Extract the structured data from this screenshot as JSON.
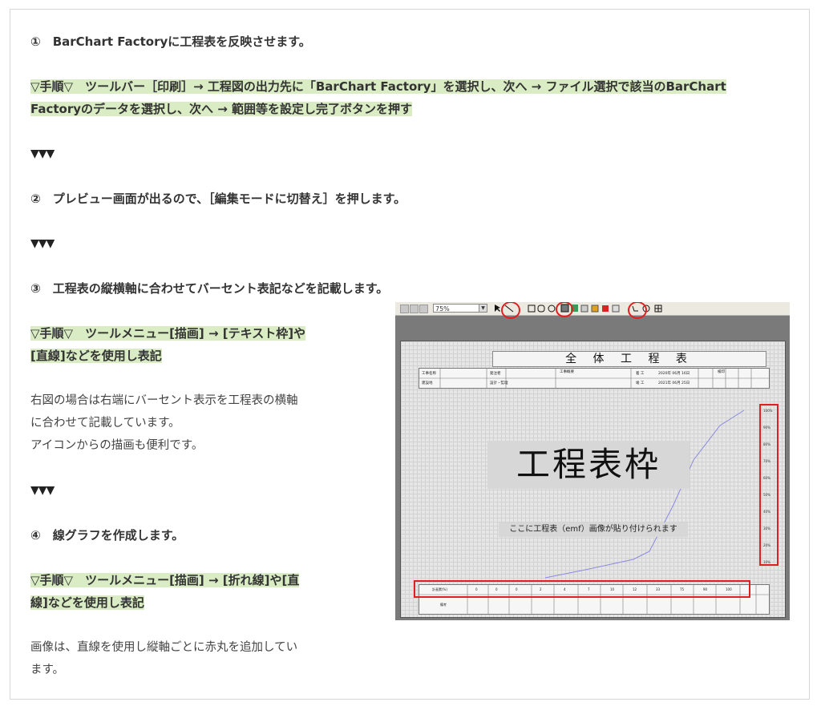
{
  "sections": {
    "step1_title": "①　BarChart Factoryに工程表を反映させます。",
    "step1_proc_line1": "▽手順▽　ツールバー［印刷］→ 工程図の出力先に「BarChart Factory」を選択し、次へ → ファイル選択で該当のBarChart",
    "step1_proc_line2": "Factoryのデータを選択し、次へ → 範囲等を設定し完了ボタンを押す",
    "arrows": "▼▼▼",
    "step2_title": "②　プレビュー画面が出るので、［編集モードに切替え］を押します。",
    "step3_title": "③　工程表の縦横軸に合わせてバーセント表記などを記載します。",
    "step3_proc_line1": "▽手順▽　ツールメニュー[描画] → [テキスト枠]や",
    "step3_proc_line2": "[直線]などを使用し表記",
    "step3_body_line1": "右図の場合は右端にバーセント表示を工程表の横軸",
    "step3_body_line2": "に合わせて記載しています。",
    "step3_body_line3": "アイコンからの描画も便利です。",
    "step4_title": "④　線グラフを作成します。",
    "step4_proc_line1": "▽手順▽　ツールメニュー[描画] → [折れ線]や[直",
    "step4_proc_line2": "線]などを使用し表記",
    "step4_body_line1": "画像は、直線を使用し縦軸ごとに赤丸を追加してい",
    "step4_body_line2": "ます。"
  },
  "screenshot": {
    "zoom": "75%",
    "sheet_title": "全 体 工 程 表",
    "header_labels": [
      "工事名称",
      "発注者",
      "工事概要",
      "着 工",
      "2020年 06月 16日",
      "検印",
      "建設地",
      "設計・監理",
      "竣 工",
      "2021年 06月 25日"
    ],
    "placeholder_big": "工程表枠",
    "placeholder_small": "ここに工程表（emf）画像が貼り付けられます",
    "percent_labels": [
      "100%",
      "90%",
      "80%",
      "70%",
      "60%",
      "50%",
      "40%",
      "30%",
      "20%",
      "10%"
    ],
    "progress_row_label": "計画累(%)",
    "progress_values": [
      "0",
      "0",
      "0",
      "2",
      "4",
      "7",
      "10",
      "12",
      "33",
      "75",
      "90",
      "100"
    ],
    "bottom_row_label": "備考",
    "line_color": "#8a8ae0",
    "highlight_color": "#e02020"
  }
}
